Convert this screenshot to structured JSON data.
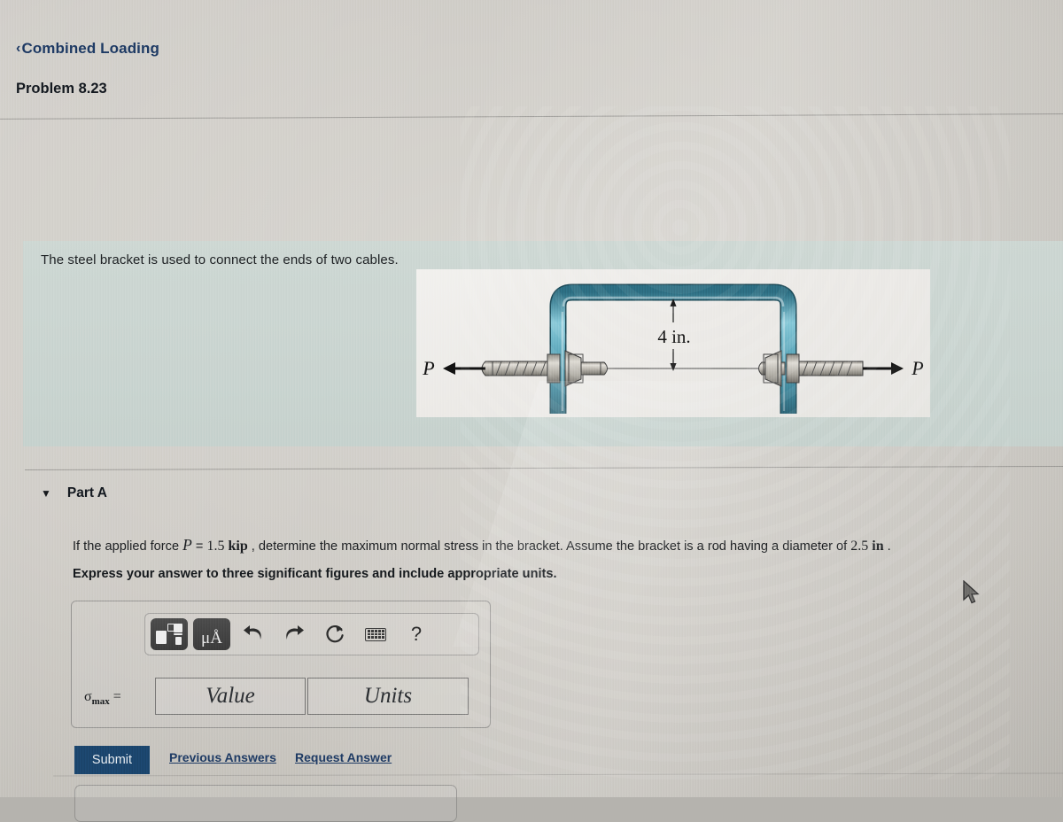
{
  "header": {
    "back_chevron": "‹",
    "breadcrumb": "Combined Loading",
    "problem_title": "Problem 8.23"
  },
  "statement": {
    "text": "The steel bracket is used to connect the ends of two cables."
  },
  "figure": {
    "name": "steel-bracket-two-cables",
    "dimension_label": "4 in.",
    "force_left_label": "P",
    "force_right_label": "P",
    "bracket_color": "#4e9aad",
    "rod_color": "#b9b5ad"
  },
  "part_a": {
    "caret": "▼",
    "label": "Part A",
    "question_pre": "If the applied force ",
    "question_symbol": "P",
    "question_eq": " = ",
    "question_value": "1.5 ",
    "question_unit": "kip",
    "question_mid": " , determine the maximum normal stress in the bracket. Assume the bracket is a rod having a diameter of ",
    "question_diameter": "2.5 ",
    "question_diameter_unit": "in",
    "question_end": " .",
    "instruction": "Express your answer to three significant figures and include appropriate units."
  },
  "toolbar": {
    "template_button": "template-icon",
    "units_button": "μÅ",
    "undo_button": "undo-icon",
    "redo_button": "redo-icon",
    "reset_button": "reset-icon",
    "keyboard_button": "keyboard-icon",
    "help_button": "?"
  },
  "answer": {
    "symbol": "σ",
    "subscript": "max",
    "equals": "=",
    "value_placeholder": "Value",
    "units_placeholder": "Units",
    "value": "",
    "units": ""
  },
  "actions": {
    "submit_label": "Submit",
    "previous_answers_label": "Previous Answers",
    "request_answer_label": "Request Answer"
  },
  "colors": {
    "link": "#1e3a63",
    "submit_bg": "#1b456d",
    "statement_band": "#c9d5d1",
    "bracket_teal": "#4e9aad"
  }
}
